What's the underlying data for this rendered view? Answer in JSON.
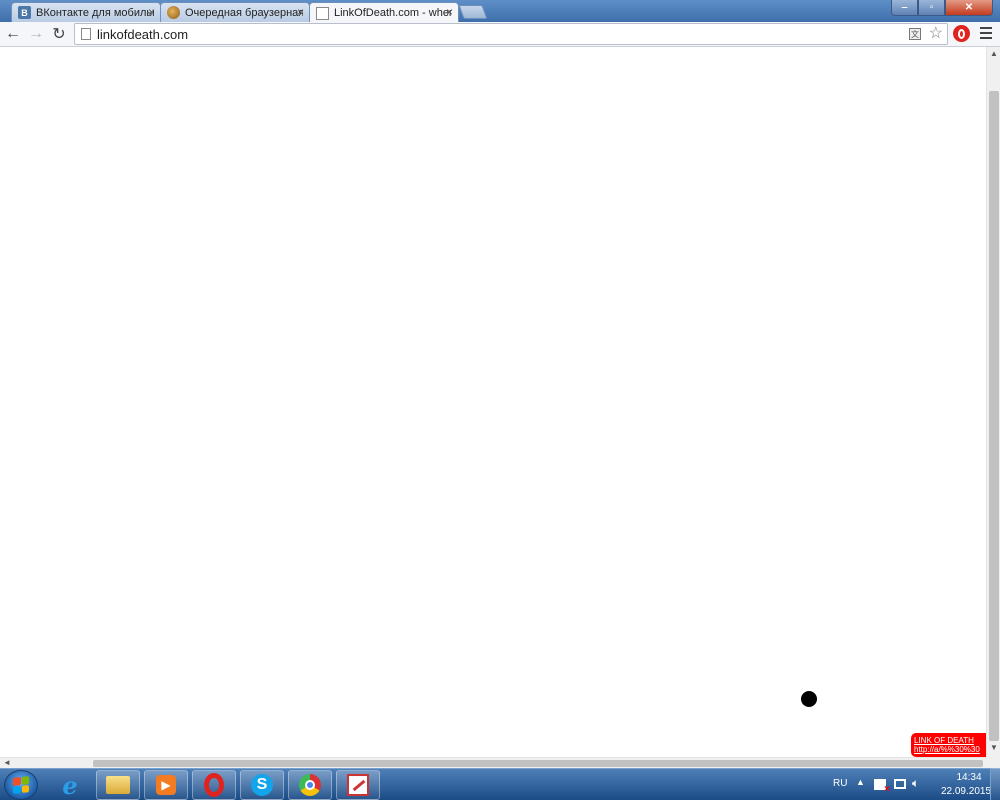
{
  "browser": {
    "tabs": [
      {
        "title": "ВКонтакте для мобильн",
        "favicon": "vk-favicon",
        "active": false
      },
      {
        "title": "Очередная браузерная у",
        "favicon": "globe-favicon",
        "active": false
      },
      {
        "title": "LinkOfDeath.com - when",
        "favicon": "page-favicon",
        "active": true
      }
    ],
    "url": "linkofdeath.com",
    "translate_icon_glyph": "文",
    "colors": {
      "titlebar": "#4a7bb7",
      "close_button": "#c23a1d",
      "badge": "#ff0000"
    }
  },
  "page": {
    "badge": {
      "title": "LINK OF DEATH",
      "link": "http://a/%%30%30"
    }
  },
  "taskbar": {
    "pinned": [
      "internet-explorer",
      "windows-explorer",
      "media-player",
      "opera",
      "skype",
      "chrome",
      "paint"
    ],
    "tray": {
      "language": "RU",
      "time": "14:34",
      "date": "22.09.2015"
    }
  }
}
